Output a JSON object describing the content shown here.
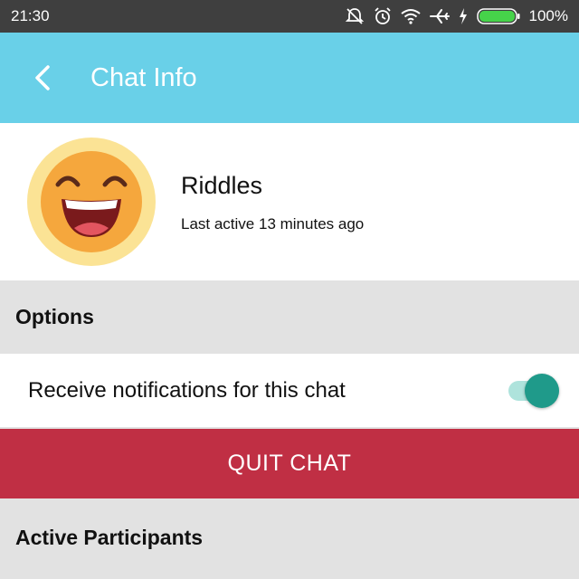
{
  "status_bar": {
    "time": "21:30",
    "battery_percent": "100%",
    "icons": [
      "do-not-disturb-icon",
      "alarm-icon",
      "wifi-icon",
      "airplane-icon",
      "charging-icon",
      "battery-icon"
    ]
  },
  "app_bar": {
    "title": "Chat Info",
    "back_icon": "chevron-left-icon",
    "color": "#69d0e8"
  },
  "profile": {
    "name": "Riddles",
    "last_active": "Last active 13 minutes ago",
    "avatar_icon": "laughing-emoji-icon"
  },
  "options": {
    "header": "Options",
    "notifications_label": "Receive notifications for this chat",
    "notifications_enabled": true
  },
  "quit_button": {
    "label": "QUIT CHAT",
    "color": "#c02f44"
  },
  "participants": {
    "header": "Active Participants"
  }
}
